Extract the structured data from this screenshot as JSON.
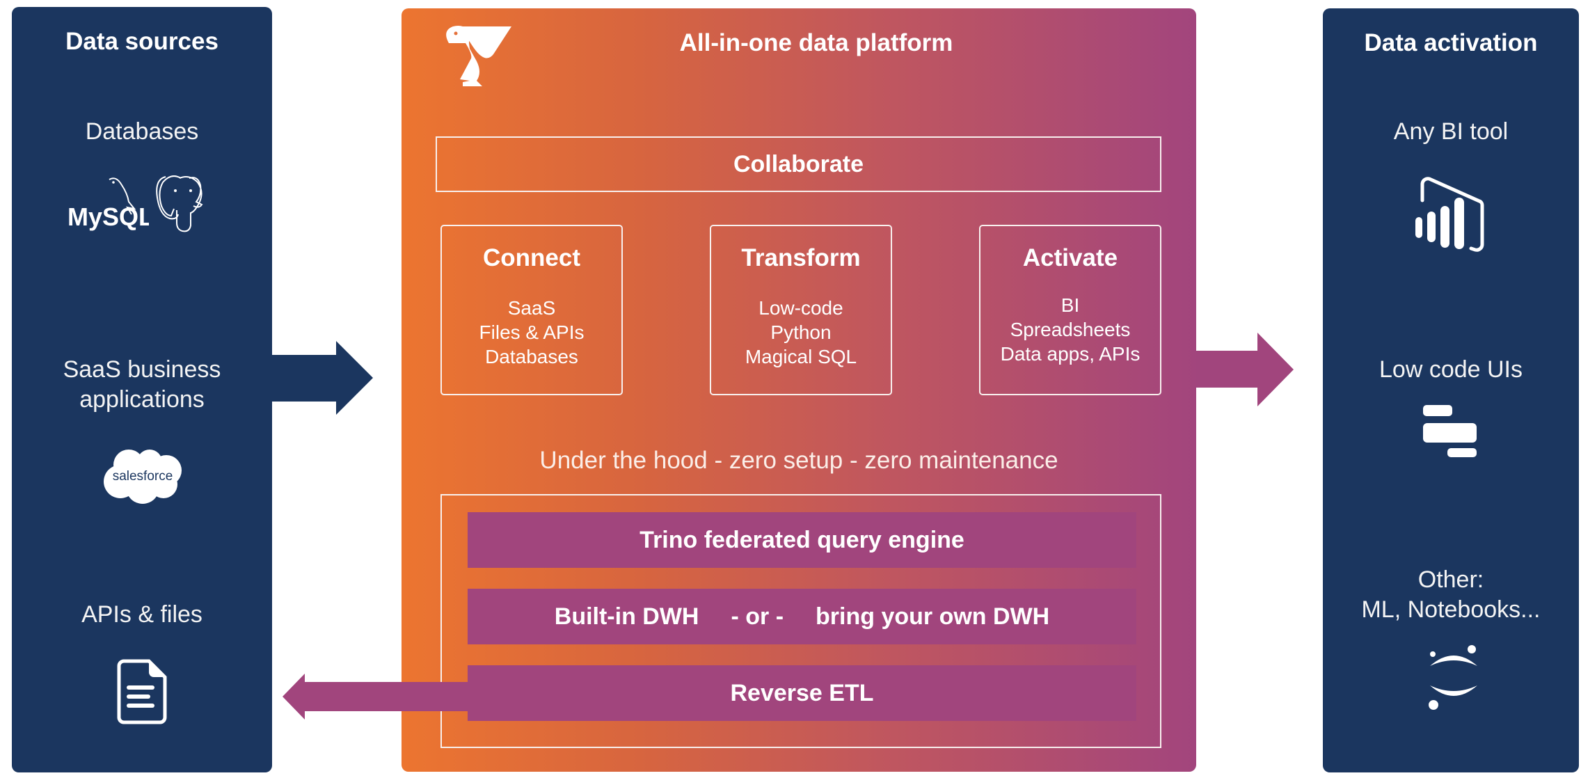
{
  "left_panel": {
    "title": "Data sources",
    "sections": [
      {
        "label": "Databases",
        "icons": [
          "mysql-logo",
          "postgresql-elephant"
        ],
        "icon_text": "MySQL"
      },
      {
        "label_line1": "SaaS business",
        "label_line2": "applications",
        "icons": [
          "salesforce-logo"
        ],
        "icon_text": "salesforce"
      },
      {
        "label": "APIs & files",
        "icons": [
          "document-icon"
        ]
      }
    ]
  },
  "center": {
    "title": "All-in-one data platform",
    "logo": "pelican-logo",
    "collaborate": "Collaborate",
    "cards": [
      {
        "title": "Connect",
        "items": [
          "SaaS",
          "Files & APIs",
          "Databases"
        ]
      },
      {
        "title": "Transform",
        "items": [
          "Low-code",
          "Python",
          "Magical SQL"
        ]
      },
      {
        "title": "Activate",
        "items": [
          "BI",
          "Spreadsheets",
          "Data apps, APIs"
        ]
      }
    ],
    "hood_label": "Under the hood - zero setup - zero maintenance",
    "layers": {
      "trino": "Trino federated query engine",
      "dwh_left": "Built-in DWH",
      "dwh_or": "- or -",
      "dwh_right": "bring your own DWH",
      "reverse_etl": "Reverse ETL"
    }
  },
  "right_panel": {
    "title": "Data activation",
    "sections": [
      {
        "label": "Any BI tool",
        "icons": [
          "power-bi-icon"
        ]
      },
      {
        "label": "Low code UIs",
        "icons": [
          "low-code-ui-icon"
        ]
      },
      {
        "label_line1": "Other:",
        "label_line2": "ML, Notebooks...",
        "icons": [
          "jupyter-icon"
        ]
      }
    ]
  },
  "colors": {
    "panel_navy": "#1b365f",
    "gradient_start": "#ec7530",
    "gradient_end": "#a2457d",
    "layer_purple": "#a1457d",
    "white": "#ffffff"
  }
}
